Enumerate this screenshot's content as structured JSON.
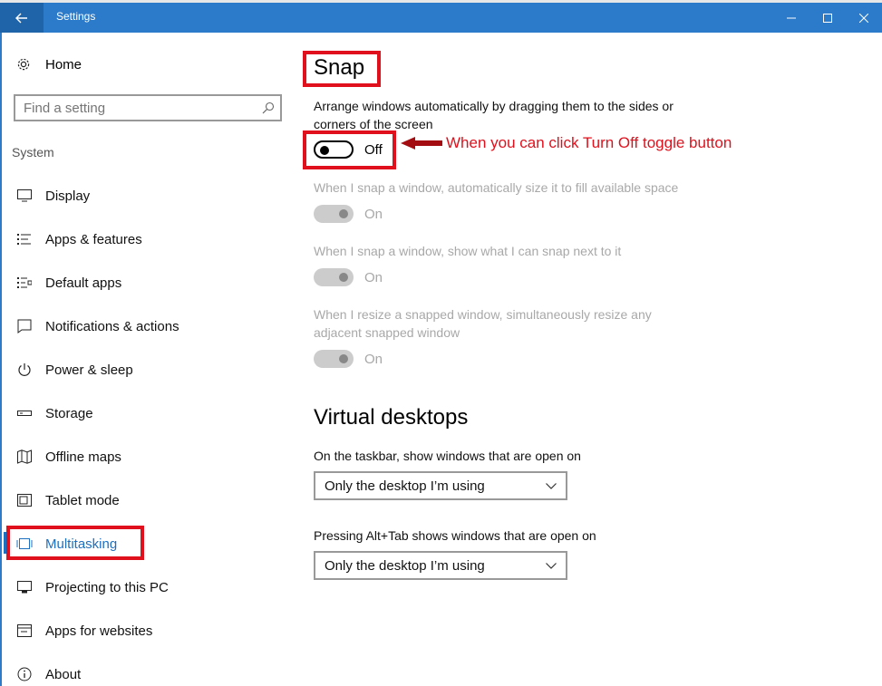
{
  "window": {
    "title": "Settings"
  },
  "sidebar": {
    "home_label": "Home",
    "search_placeholder": "Find a setting",
    "section_label": "System",
    "items": [
      {
        "label": "Display",
        "icon": "monitor-icon"
      },
      {
        "label": "Apps & features",
        "icon": "list-icon"
      },
      {
        "label": "Default apps",
        "icon": "default-apps-icon"
      },
      {
        "label": "Notifications & actions",
        "icon": "notification-icon"
      },
      {
        "label": "Power & sleep",
        "icon": "power-icon"
      },
      {
        "label": "Storage",
        "icon": "storage-icon"
      },
      {
        "label": "Offline maps",
        "icon": "map-icon"
      },
      {
        "label": "Tablet mode",
        "icon": "tablet-icon"
      },
      {
        "label": "Multitasking",
        "icon": "multitasking-icon",
        "active": true
      },
      {
        "label": "Projecting to this PC",
        "icon": "projecting-icon"
      },
      {
        "label": "Apps for websites",
        "icon": "apps-websites-icon"
      },
      {
        "label": "About",
        "icon": "info-icon"
      }
    ]
  },
  "snap": {
    "heading": "Snap",
    "desc_line1": "Arrange windows automatically by dragging them to the sides or",
    "desc_line2": "corners of the screen",
    "main_toggle": "Off",
    "annotation": "When you can click Turn Off toggle button",
    "options": [
      {
        "label_line1": "When I snap a window, automatically size it to fill available space",
        "label_line2": "",
        "state": "On"
      },
      {
        "label_line1": "When I snap a window, show what I can snap next to it",
        "label_line2": "",
        "state": "On"
      },
      {
        "label_line1": "When I resize a snapped window, simultaneously resize any",
        "label_line2": "adjacent snapped window",
        "state": "On"
      }
    ]
  },
  "virtual_desktops": {
    "heading": "Virtual desktops",
    "taskbar_label": "On the taskbar, show windows that are open on",
    "taskbar_value": "Only the desktop I’m using",
    "alttab_label": "Pressing Alt+Tab shows windows that are open on",
    "alttab_value": "Only the desktop I’m using"
  },
  "colors": {
    "accent": "#2b7bca",
    "active_nav": "#1d6fc0",
    "annotation": "#e0101c"
  }
}
